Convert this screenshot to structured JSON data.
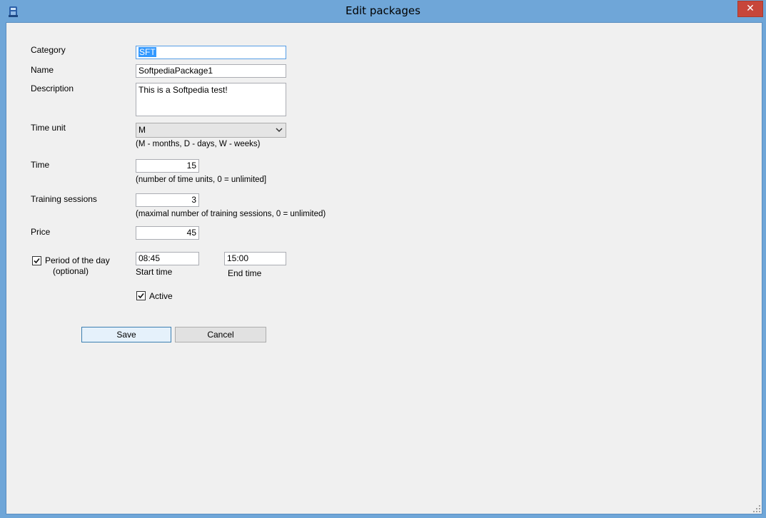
{
  "window": {
    "title": "Edit packages",
    "close_glyph": "✕"
  },
  "form": {
    "category": {
      "label": "Category",
      "value": "SFT"
    },
    "name": {
      "label": "Name",
      "value": "SoftpediaPackage1"
    },
    "description": {
      "label": "Description",
      "value": "This is a Softpedia test!"
    },
    "time_unit": {
      "label": "Time unit",
      "value": "M",
      "hint": "(M - months, D - days, W - weeks)"
    },
    "time": {
      "label": "Time",
      "value": "15",
      "hint": "(number of time units, 0 = unlimited]"
    },
    "training_sessions": {
      "label": "Training sessions",
      "value": "3",
      "hint": "(maximal number of training sessions,  0 = unlimited)"
    },
    "price": {
      "label": "Price",
      "value": "45"
    },
    "period": {
      "label": "Period of the day",
      "label_sub": "(optional)",
      "checked": true,
      "start_value": "08:45",
      "start_label": "Start time",
      "end_value": "15:00",
      "end_label": "End time"
    },
    "active": {
      "label": "Active",
      "checked": true
    }
  },
  "buttons": {
    "save": "Save",
    "cancel": "Cancel"
  },
  "icons": {
    "app": "app-icon",
    "close": "close-icon",
    "checkbox": "checkmark-icon",
    "dropdown": "chevron-down-icon",
    "grip": "resize-grip-icon"
  }
}
